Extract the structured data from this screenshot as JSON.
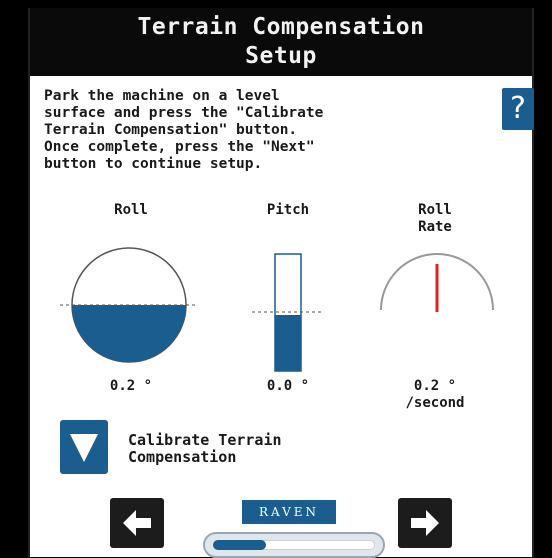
{
  "header": {
    "title": "Terrain Compensation Setup"
  },
  "instructions": "Park the machine on a level\nsurface and press the \"Calibrate\nTerrain Compensation\" button.\nOnce complete, press the \"Next\"\nbutton to continue setup.",
  "help": {
    "label": "?"
  },
  "gauges": {
    "roll": {
      "label": "Roll",
      "value": "0.2 °"
    },
    "pitch": {
      "label": "Pitch",
      "value": "0.0 °"
    },
    "roll_rate": {
      "label": "Roll\nRate",
      "value": "0.2 °\n/second"
    }
  },
  "calibrate": {
    "label": "Calibrate Terrain\nCompensation"
  },
  "nav": {
    "logo_text": "RAVEN",
    "progress_fraction": 0.33
  },
  "colors": {
    "accent": "#1a5d8e",
    "needle": "#e0202a",
    "title_bg": "#0a0a0a"
  }
}
